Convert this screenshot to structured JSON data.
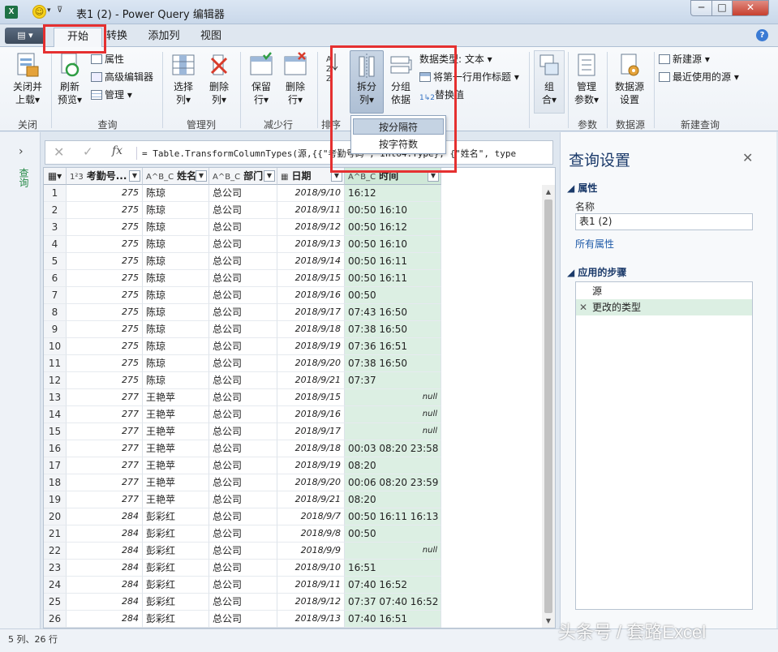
{
  "window": {
    "title": "表1 (2) - Power Query 编辑器",
    "excel_icon": "X",
    "min": "─",
    "max": "□",
    "close": "✕"
  },
  "tabs": {
    "file": "▤ ▾",
    "home": "开始",
    "transform": "转换",
    "add_column": "添加列",
    "view": "视图",
    "help": "?"
  },
  "ribbon": {
    "close_load": "关闭并\n上载▾",
    "refresh_preview": "刷新\n预览▾",
    "properties": "属性",
    "advanced_editor": "高级编辑器",
    "manage": "管理 ▾",
    "choose_columns": "选择\n列▾",
    "remove_columns": "删除\n列▾",
    "keep_rows": "保留\n行▾",
    "remove_rows": "删除\n行▾",
    "sort_label": "排序",
    "split_column": "拆分\n列▾",
    "group_by": "分组\n依据",
    "data_type": "数据类型: 文本 ▾",
    "first_row_header": "将第一行用作标题 ▾",
    "replace_values": "替换值",
    "transform_label": "换",
    "combine": "组\n合▾",
    "manage_params": "管理\n参数▾",
    "data_source_settings": "数据源\n设置",
    "new_source": "新建源 ▾",
    "recent_sources": "最近使用的源 ▾",
    "groups": {
      "close": "关闭",
      "query": "查询",
      "manage_columns": "管理列",
      "reduce_rows": "减少行",
      "parameters": "参数",
      "data_sources": "数据源",
      "new_query": "新建查询"
    }
  },
  "split_menu": {
    "by_delimiter": "按分隔符",
    "by_char_count": "按字符数"
  },
  "left_nav": {
    "arrow": "›",
    "label": "查询"
  },
  "formula_bar": {
    "cancel": "✕",
    "confirm": "✓",
    "fx": "fx",
    "formula": "= Table.TransformColumnTypes(源,{{\"考勤号码\", Int64.Type}, {\"姓名\", type"
  },
  "columns": [
    {
      "type_icon": "1²3",
      "name": "考勤号..."
    },
    {
      "type_icon": "A^B_C",
      "name": "姓名"
    },
    {
      "type_icon": "A^B_C",
      "name": "部门"
    },
    {
      "type_icon": "▦",
      "name": "日期"
    },
    {
      "type_icon": "A^B_C",
      "name": "时间"
    }
  ],
  "rows": [
    [
      "1",
      "275",
      "陈琼",
      "总公司",
      "2018/9/10",
      "16:12"
    ],
    [
      "2",
      "275",
      "陈琼",
      "总公司",
      "2018/9/11",
      "00:50 16:10"
    ],
    [
      "3",
      "275",
      "陈琼",
      "总公司",
      "2018/9/12",
      "00:50 16:12"
    ],
    [
      "4",
      "275",
      "陈琼",
      "总公司",
      "2018/9/13",
      "00:50 16:10"
    ],
    [
      "5",
      "275",
      "陈琼",
      "总公司",
      "2018/9/14",
      "00:50 16:11"
    ],
    [
      "6",
      "275",
      "陈琼",
      "总公司",
      "2018/9/15",
      "00:50 16:11"
    ],
    [
      "7",
      "275",
      "陈琼",
      "总公司",
      "2018/9/16",
      "00:50"
    ],
    [
      "8",
      "275",
      "陈琼",
      "总公司",
      "2018/9/17",
      "07:43 16:50"
    ],
    [
      "9",
      "275",
      "陈琼",
      "总公司",
      "2018/9/18",
      "07:38 16:50"
    ],
    [
      "10",
      "275",
      "陈琼",
      "总公司",
      "2018/9/19",
      "07:36 16:51"
    ],
    [
      "11",
      "275",
      "陈琼",
      "总公司",
      "2018/9/20",
      "07:38 16:50"
    ],
    [
      "12",
      "275",
      "陈琼",
      "总公司",
      "2018/9/21",
      "07:37"
    ],
    [
      "13",
      "277",
      "王艳苹",
      "总公司",
      "2018/9/15",
      "null"
    ],
    [
      "14",
      "277",
      "王艳苹",
      "总公司",
      "2018/9/16",
      "null"
    ],
    [
      "15",
      "277",
      "王艳苹",
      "总公司",
      "2018/9/17",
      "null"
    ],
    [
      "16",
      "277",
      "王艳苹",
      "总公司",
      "2018/9/18",
      "00:03 08:20 23:58"
    ],
    [
      "17",
      "277",
      "王艳苹",
      "总公司",
      "2018/9/19",
      "08:20"
    ],
    [
      "18",
      "277",
      "王艳苹",
      "总公司",
      "2018/9/20",
      "00:06 08:20 23:59"
    ],
    [
      "19",
      "277",
      "王艳苹",
      "总公司",
      "2018/9/21",
      "08:20"
    ],
    [
      "20",
      "284",
      "彭彩红",
      "总公司",
      "2018/9/7",
      "00:50 16:11 16:13"
    ],
    [
      "21",
      "284",
      "彭彩红",
      "总公司",
      "2018/9/8",
      "00:50"
    ],
    [
      "22",
      "284",
      "彭彩红",
      "总公司",
      "2018/9/9",
      "null"
    ],
    [
      "23",
      "284",
      "彭彩红",
      "总公司",
      "2018/9/10",
      "16:51"
    ],
    [
      "24",
      "284",
      "彭彩红",
      "总公司",
      "2018/9/11",
      "07:40 16:52"
    ],
    [
      "25",
      "284",
      "彭彩红",
      "总公司",
      "2018/9/12",
      "07:37 07:40 16:52"
    ],
    [
      "26",
      "284",
      "彭彩红",
      "总公司",
      "2018/9/13",
      "07:40 16:51"
    ]
  ],
  "query_settings": {
    "title": "查询设置",
    "close": "✕",
    "properties_header": "◢ 属性",
    "name_label": "名称",
    "name_value": "表1 (2)",
    "all_properties": "所有属性",
    "steps_header": "◢ 应用的步骤",
    "steps": [
      "源",
      "更改的类型"
    ]
  },
  "status": {
    "text": "5 列、26 行"
  },
  "watermark": "头条号 / 套路Excel",
  "colors": {
    "accent_green": "#dcefe3",
    "highlight_red": "#e53030",
    "link_blue": "#1e5aa8"
  }
}
